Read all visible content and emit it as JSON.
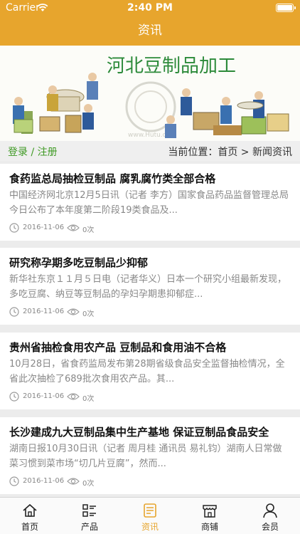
{
  "status_bar": {
    "carrier": "Carrier",
    "time": "2:40 PM"
  },
  "nav": {
    "title": "资讯"
  },
  "banner": {
    "title": "河北豆制品加工",
    "watermark": "www.Hutu.com"
  },
  "subbar": {
    "login": "登录",
    "separator": "/",
    "register": "注册",
    "breadcrumb": "当前位置：首页 > 新闻资讯"
  },
  "news": [
    {
      "title": "食药监总局抽检豆制品 腐乳腐竹类全部合格",
      "summary": "中国经济网北京12月5日讯（记者 李方）国家食品药品监督管理总局今日公布了本年度第二阶段19类食品及...",
      "date": "2016-11-06",
      "views": "0次"
    },
    {
      "title": "研究称孕期多吃豆制品少抑郁",
      "summary": "新华社东京１１月５日电（记者华义）日本一个研究小组最新发现，多吃豆腐、纳豆等豆制品的孕妇孕期患抑郁症...",
      "date": "2016-11-06",
      "views": "0次"
    },
    {
      "title": "贵州省抽检食用农产品 豆制品和食用油不合格",
      "summary": "10月28日，省食药监局发布第28期省级食品安全监督抽检情况，全省此次抽检了689批次食用农产品。其...",
      "date": "2016-11-06",
      "views": "0次"
    },
    {
      "title": "长沙建成九大豆制品集中生产基地 保证豆制品食品安全",
      "summary": "湖南日报10月30日讯（记者 周月桂 通讯员 易礼钧）湖南人日常做菜习惯到菜市场“切几片豆腐”，然而...",
      "date": "2016-11-06",
      "views": "0次"
    }
  ],
  "tabs": [
    {
      "label": "首页",
      "icon": "home-icon"
    },
    {
      "label": "产品",
      "icon": "product-list-icon"
    },
    {
      "label": "资讯",
      "icon": "news-icon",
      "active": true
    },
    {
      "label": "商铺",
      "icon": "shop-icon"
    },
    {
      "label": "会员",
      "icon": "member-icon"
    }
  ],
  "colors": {
    "accent": "#e7a52d",
    "login_green": "#3f9a24",
    "muted": "#888888"
  }
}
